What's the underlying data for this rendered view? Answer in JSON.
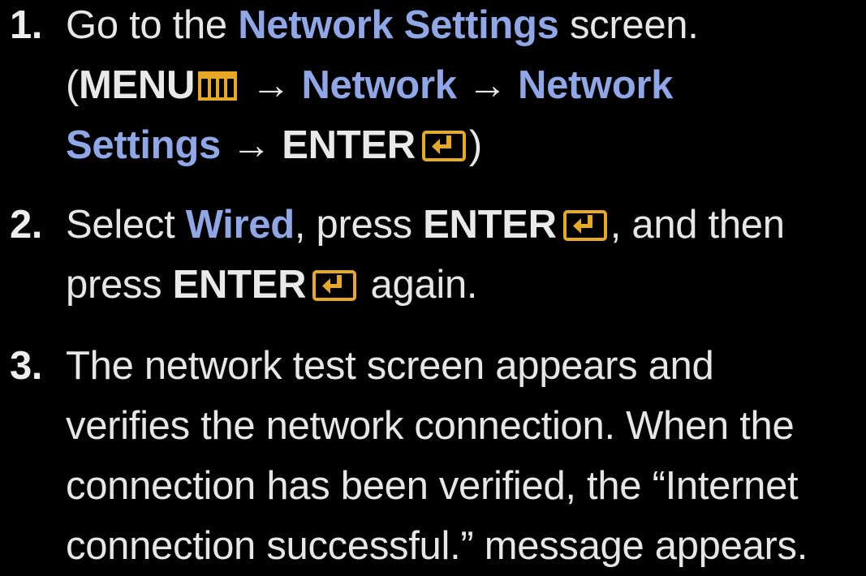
{
  "steps": [
    {
      "number": "1.",
      "lines": [
        [
          "Go to the ",
          "Network Settings",
          " screen."
        ],
        [
          "(",
          "MENU",
          " → ",
          "Network",
          " → ",
          "Network"
        ],
        [
          "Settings",
          " → ",
          "ENTER",
          ")"
        ]
      ]
    },
    {
      "number": "2.",
      "lines": [
        [
          "Select ",
          "Wired",
          ", press ",
          "ENTER",
          ", and then"
        ],
        [
          "press ",
          "ENTER",
          " again."
        ]
      ]
    },
    {
      "number": "3.",
      "lines": [
        [
          "The network test screen appears and"
        ],
        [
          "verifies the network connection. When the"
        ],
        [
          "connection has been verified, the “Internet"
        ],
        [
          "connection successful.” message appears."
        ]
      ]
    }
  ],
  "icons": {
    "menu": "menu-icon",
    "enter": "enter-icon"
  },
  "colors": {
    "background": "#000000",
    "text": "#e6e6e6",
    "highlight": "#8fa7e6",
    "icon": "#e7a823"
  }
}
